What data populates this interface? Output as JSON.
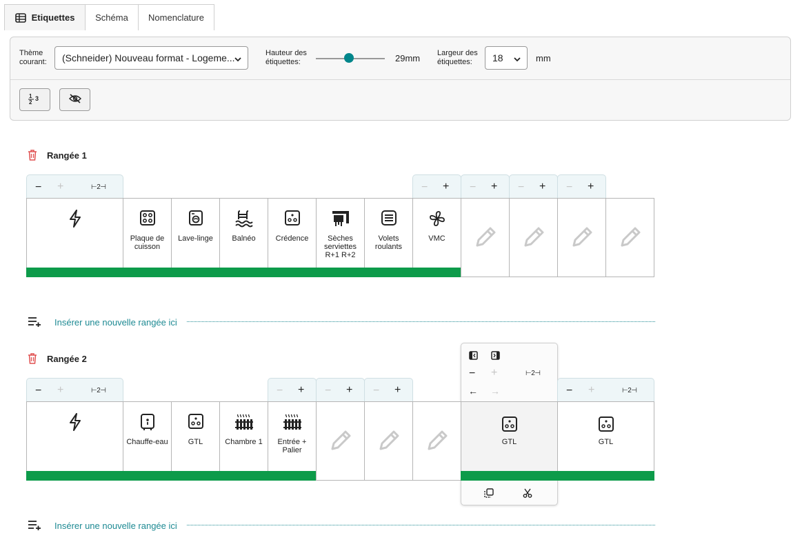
{
  "tabs": [
    {
      "label": "Etiquettes",
      "icon": "table-icon"
    },
    {
      "label": "Schéma"
    },
    {
      "label": "Nomenclature"
    }
  ],
  "toolbar": {
    "theme_label": "Thème courant:",
    "theme_value": "(Schneider) Nouveau format - Logeme...",
    "height_label": "Hauteur des étiquettes:",
    "height_value": "29mm",
    "height_level_mm": 29,
    "width_label": "Largeur des étiquettes:",
    "width_value": "18",
    "width_unit": "mm",
    "buttons": [
      {
        "icon": "numbering-icon"
      },
      {
        "icon": "eye-off-icon"
      }
    ]
  },
  "rows": [
    {
      "title": "Rangée 1",
      "span_label": "⊢2⊣",
      "modules": [
        {
          "name": "",
          "icon": "lightning-icon"
        },
        {
          "name": "Plaque de cuisson",
          "icon": "cooktop-icon"
        },
        {
          "name": "Lave-linge",
          "icon": "washing-machine-icon"
        },
        {
          "name": "Balnéo",
          "icon": "pool-icon"
        },
        {
          "name": "Crédence",
          "icon": "outlet-icon"
        },
        {
          "name": "Sèches serviettes R+1 R+2",
          "icon": "towel-dryer-icon"
        },
        {
          "name": "Volets roulants",
          "icon": "shutter-icon"
        },
        {
          "name": "VMC",
          "icon": "fan-icon"
        }
      ]
    },
    {
      "title": "Rangée 2",
      "span_label": "⊢2⊣",
      "modules": [
        {
          "name": "",
          "icon": "lightning-icon"
        },
        {
          "name": "Chauffe-eau",
          "icon": "water-heater-icon"
        },
        {
          "name": "GTL",
          "icon": "outlet-icon"
        },
        {
          "name": "Chambre 1",
          "icon": "radiator-icon"
        },
        {
          "name": "Entrée + Palier",
          "icon": "radiator-icon"
        },
        {
          "name": "GTL",
          "icon": "outlet-icon"
        },
        {
          "name": "GTL",
          "icon": "outlet-icon"
        }
      ]
    }
  ],
  "insert_label": "Insérer une nouvelle rangée ici",
  "colors": {
    "accent": "#00868b",
    "bar": "#0d9b4a",
    "link": "#1e8a93",
    "trash": "#e05050"
  }
}
